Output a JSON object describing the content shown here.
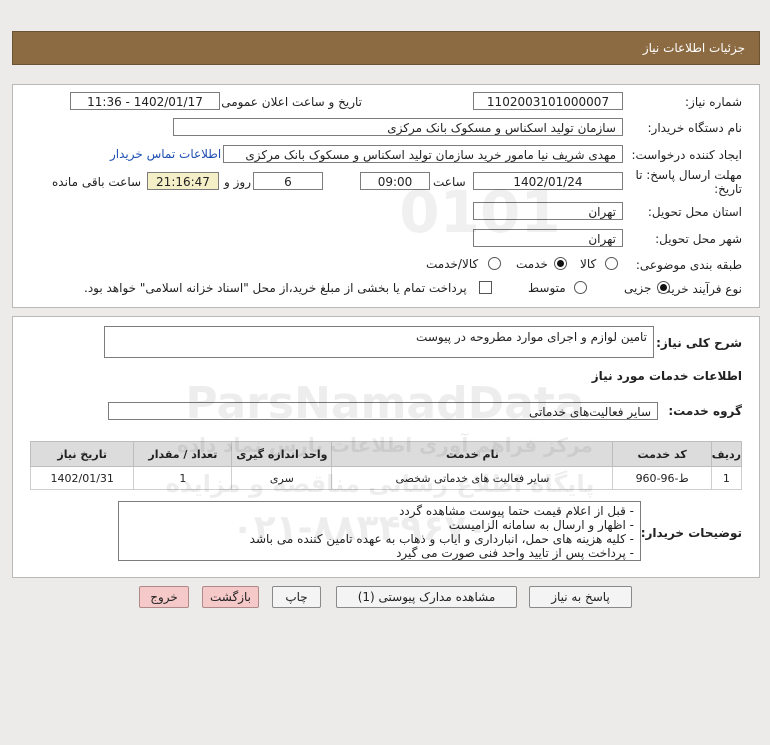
{
  "header": {
    "title": "جزئیات اطلاعات نیاز"
  },
  "form": {
    "need_number": {
      "label": "شماره نیاز:",
      "value": "1102003101000007"
    },
    "announce_datetime": {
      "label": "تاریخ و ساعت اعلان عمومی:",
      "value": "1402/01/17 - 11:36"
    },
    "buyer_org": {
      "label": "نام دستگاه خریدار:",
      "value": "سازمان تولید اسکناس و مسکوک بانک مرکزی"
    },
    "requester": {
      "label": "ایجاد کننده درخواست:",
      "value": "مهدی شریف نیا مامور خرید سازمان تولید اسکناس و مسکوک بانک مرکزی",
      "contact_link": "اطلاعات تماس خریدار"
    },
    "deadline": {
      "label_line1": "مهلت ارسال پاسخ: تا",
      "label_line2": "تاریخ:",
      "date": "1402/01/24",
      "time_label": "ساعت",
      "time": "09:00",
      "days": "6",
      "days_label": "روز و",
      "remaining": "21:16:47",
      "remaining_label": "ساعت باقی مانده"
    },
    "delivery_province": {
      "label": "استان محل تحویل:",
      "value": "تهران"
    },
    "delivery_city": {
      "label": "شهر محل تحویل:",
      "value": "تهران"
    },
    "category": {
      "label": "طبقه بندی موضوعی:",
      "options": [
        "کالا",
        "خدمت",
        "کالا/خدمت"
      ],
      "selected": "خدمت"
    },
    "process_type": {
      "label": "نوع فرآیند خرید :",
      "options": [
        "جزیی",
        "متوسط"
      ],
      "selected": "جزیی",
      "payment_note": "پرداخت تمام یا بخشی از مبلغ خرید،از محل \"اسناد خزانه اسلامی\" خواهد بود."
    }
  },
  "details": {
    "summary_label": "شرح کلی نیاز:",
    "summary_value": "تامین لوازم و اجرای موارد مطروحه در پیوست",
    "services_heading": "اطلاعات خدمات مورد نیاز",
    "service_group_label": "گروه خدمت:",
    "service_group_value": "سایر فعالیت‌های خدماتی",
    "table": {
      "headers": [
        "ردیف",
        "کد خدمت",
        "نام خدمت",
        "واحد اندازه گیری",
        "تعداد / مقدار",
        "تاریخ نیاز"
      ],
      "rows": [
        [
          "1",
          "ط-96-960",
          "سایر فعالیت های خدماتی شخصی",
          "سری",
          "1",
          "1402/01/31"
        ]
      ]
    },
    "buyer_notes_label": "توضیحات خریدار:",
    "buyer_notes": [
      "- قبل از اعلام قیمت حتما پیوست مشاهده گردد",
      "- اظهار و ارسال به سامانه الزامیست",
      "- کلیه هزینه های حمل، انبارداری و ایاب و ذهاب به عهده تامین کننده می باشد",
      "- پرداخت پس از تایید واحد فنی صورت می گیرد"
    ]
  },
  "buttons": {
    "reply": "پاسخ به نیاز",
    "view_docs": "مشاهده مدارک پیوستی (1)",
    "print": "چاپ",
    "back": "بازگشت",
    "exit": "خروج"
  },
  "watermark": {
    "brand": "ParsNamadData",
    "line1": "مرکز فراهم آوری اطلاعات پارس نماد داده",
    "line2": "پایگاه اطلاع رسانی مناقصه و مزایده",
    "phone": "۰۲۱-۸۸۳۴۹۶۷۰"
  },
  "colors": {
    "header_bg": "#8c6b43",
    "remaining_bg": "#f5efc8",
    "link": "#1f4fb3",
    "exit_button": "#f6c9c9"
  }
}
